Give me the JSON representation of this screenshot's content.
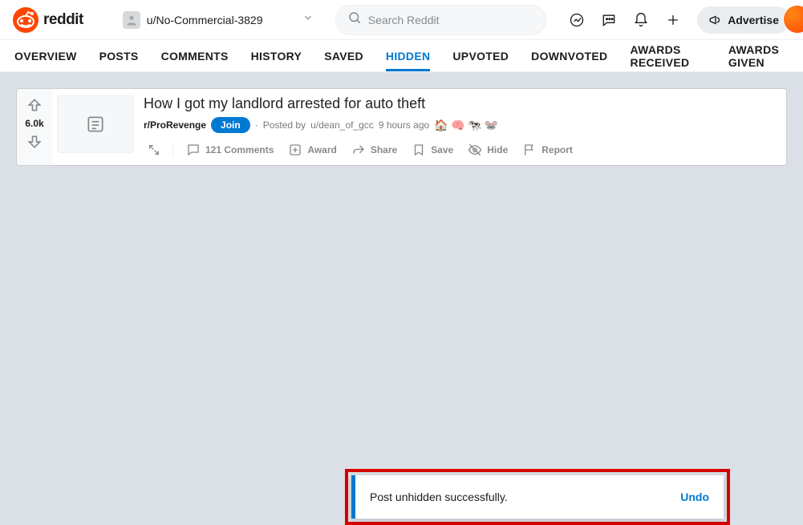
{
  "header": {
    "brand": "reddit",
    "username": "u/No-Commercial-3829",
    "search_placeholder": "Search Reddit",
    "advertise_label": "Advertise"
  },
  "tabs": [
    {
      "id": "overview",
      "label": "OVERVIEW",
      "active": false
    },
    {
      "id": "posts",
      "label": "POSTS",
      "active": false
    },
    {
      "id": "comments",
      "label": "COMMENTS",
      "active": false
    },
    {
      "id": "history",
      "label": "HISTORY",
      "active": false
    },
    {
      "id": "saved",
      "label": "SAVED",
      "active": false
    },
    {
      "id": "hidden",
      "label": "HIDDEN",
      "active": true
    },
    {
      "id": "upvoted",
      "label": "UPVOTED",
      "active": false
    },
    {
      "id": "downvoted",
      "label": "DOWNVOTED",
      "active": false
    },
    {
      "id": "awards_received",
      "label": "AWARDS RECEIVED",
      "active": false
    },
    {
      "id": "awards_given",
      "label": "AWARDS GIVEN",
      "active": false
    }
  ],
  "post": {
    "score": "6.0k",
    "title": "How I got my landlord arrested for auto theft",
    "subreddit": "r/ProRevenge",
    "join_label": "Join",
    "posted_by_prefix": "Posted by",
    "author": "u/dean_of_gcc",
    "time": "9 hours ago",
    "awards": [
      "🏠",
      "🧠",
      "🐄",
      "🐭"
    ],
    "actions": {
      "comments": "121 Comments",
      "award": "Award",
      "share": "Share",
      "save": "Save",
      "hide": "Hide",
      "report": "Report"
    }
  },
  "toast": {
    "message": "Post unhidden successfully.",
    "undo_label": "Undo"
  }
}
